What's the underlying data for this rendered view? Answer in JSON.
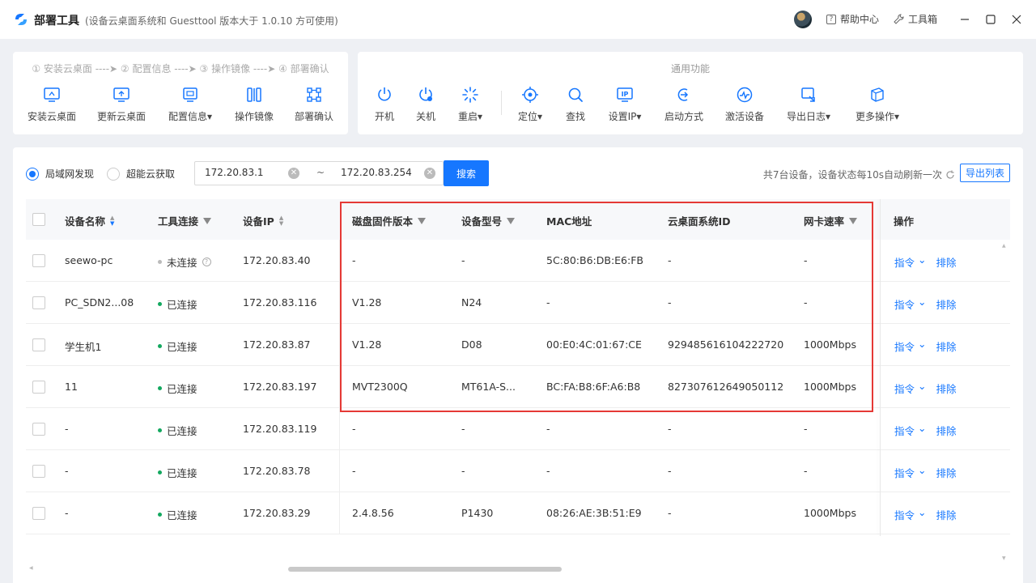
{
  "title": {
    "app_name": "部署工具",
    "subtitle": "(设备云桌面系统和 Guesttool 版本大于 1.0.10 方可使用)",
    "help": "帮助中心",
    "toolbox": "工具箱"
  },
  "deploy_panel": {
    "steps": "① 安装云桌面 ----➤ ② 配置信息 ----➤ ③ 操作镜像 ----➤ ④ 部署确认",
    "tools": [
      "安装云桌面",
      "更新云桌面",
      "配置信息▾",
      "操作镜像",
      "部署确认"
    ]
  },
  "common_panel": {
    "title": "通用功能",
    "tools": [
      "开机",
      "关机",
      "重启▾",
      "定位▾",
      "查找",
      "设置IP▾",
      "启动方式",
      "激活设备",
      "导出日志▾",
      "更多操作▾"
    ]
  },
  "discovery": {
    "lan": "局域网发现",
    "cloud": "超能云获取",
    "ip_start": "172.20.83.1",
    "ip_end": "172.20.83.254",
    "tilde": "~",
    "search": "搜索",
    "summary": "共7台设备，设备状态每10s自动刷新一次",
    "export": "导出列表"
  },
  "table": {
    "headers": {
      "name": "设备名称",
      "tool": "工具连接",
      "ip": "设备IP",
      "firmware": "磁盘固件版本",
      "model": "设备型号",
      "mac": "MAC地址",
      "sysid": "云桌面系统ID",
      "speed": "网卡速率",
      "op": "操作"
    },
    "op_cmd": "指令",
    "op_exclude": "排除",
    "rows": [
      {
        "name": "seewo-pc",
        "status": "未连接",
        "ip": "172.20.83.40",
        "firmware": "-",
        "model": "-",
        "mac": "5C:80:B6:DB:E6:FB",
        "sysid": "-",
        "speed": "-"
      },
      {
        "name": "PC_SDN2...08",
        "status": "已连接",
        "ip": "172.20.83.116",
        "firmware": "V1.28",
        "model": "N24",
        "mac": "-",
        "sysid": "-",
        "speed": "-"
      },
      {
        "name": "学生机1",
        "status": "已连接",
        "ip": "172.20.83.87",
        "firmware": "V1.28",
        "model": "D08",
        "mac": "00:E0:4C:01:67:CE",
        "sysid": "929485616104222720",
        "speed": "1000Mbps"
      },
      {
        "name": "11",
        "status": "已连接",
        "ip": "172.20.83.197",
        "firmware": "MVT2300Q",
        "model": "MT61A-S...",
        "mac": "BC:FA:B8:6F:A6:B8",
        "sysid": "827307612649050112",
        "speed": "1000Mbps"
      },
      {
        "name": "-",
        "status": "已连接",
        "ip": "172.20.83.119",
        "firmware": "-",
        "model": "-",
        "mac": "-",
        "sysid": "-",
        "speed": "-"
      },
      {
        "name": "-",
        "status": "已连接",
        "ip": "172.20.83.78",
        "firmware": "-",
        "model": "-",
        "mac": "-",
        "sysid": "-",
        "speed": "-"
      },
      {
        "name": "-",
        "status": "已连接",
        "ip": "172.20.83.29",
        "firmware": "2.4.8.56",
        "model": "P1430",
        "mac": "08:26:AE:3B:51:E9",
        "sysid": "-",
        "speed": "1000Mbps"
      }
    ]
  },
  "colors": {
    "accent": "#1677ff",
    "connected": "#13a85f",
    "disconnected": "#bbbbbb",
    "highlight": "#e53935"
  }
}
